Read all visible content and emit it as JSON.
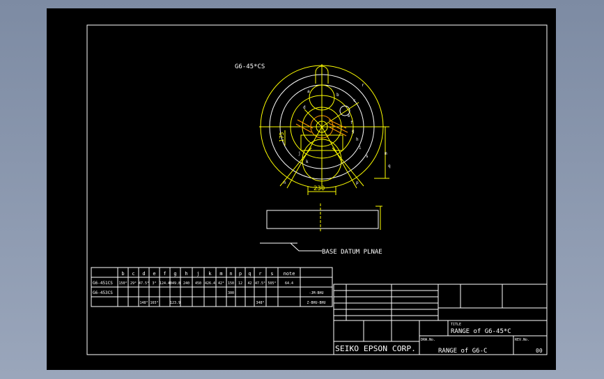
{
  "drawing": {
    "model_label": "G6-45*CS",
    "dim_width": "230",
    "dim_height": "175",
    "datum_label": "BASE DATUM PLNAE",
    "letters": [
      "a",
      "b",
      "c",
      "d",
      "e",
      "f",
      "g",
      "h",
      "i",
      "j",
      "k",
      "m",
      "n",
      "p",
      "q",
      "r",
      "s"
    ]
  },
  "spec_table": {
    "headers": [
      "",
      "b",
      "c",
      "d",
      "e",
      "f",
      "g",
      "h",
      "j",
      "k",
      "m",
      "n",
      "p",
      "q",
      "r",
      "s",
      "note"
    ],
    "rows": [
      [
        "G6-451CS",
        "150°",
        "29°",
        "47.5°",
        "3°",
        "124.4",
        "049.8",
        "240",
        "450",
        "426.4",
        "42°",
        "150",
        "12",
        "42",
        "47.5°",
        "505°",
        "64.4",
        ""
      ],
      [
        "G6-453CS",
        "",
        "",
        "",
        "",
        "",
        "",
        "",
        "",
        "",
        "",
        "300",
        "",
        "",
        "",
        "",
        "",
        "-JM-BHU"
      ],
      [
        "",
        "",
        "",
        "148°",
        "165°",
        "",
        "123.9",
        "",
        "",
        "",
        "",
        "",
        "",
        "",
        "348°",
        "",
        "",
        "Z-BHU-BHU"
      ]
    ]
  },
  "title_block": {
    "title_caption": "TITLE",
    "title": "RANGE of G6-45*C",
    "drw_caption": "DRW.No.",
    "drw_no": "RANGE of G6-C",
    "rev_caption": "REV.No.",
    "rev": "00",
    "company": "SEIKO EPSON CORP."
  },
  "colors": {
    "background": "#000000",
    "line_white": "#ffffff",
    "line_yellow": "#ffff00",
    "line_orange": "#ff9900",
    "desktop": "#8b97ad"
  }
}
